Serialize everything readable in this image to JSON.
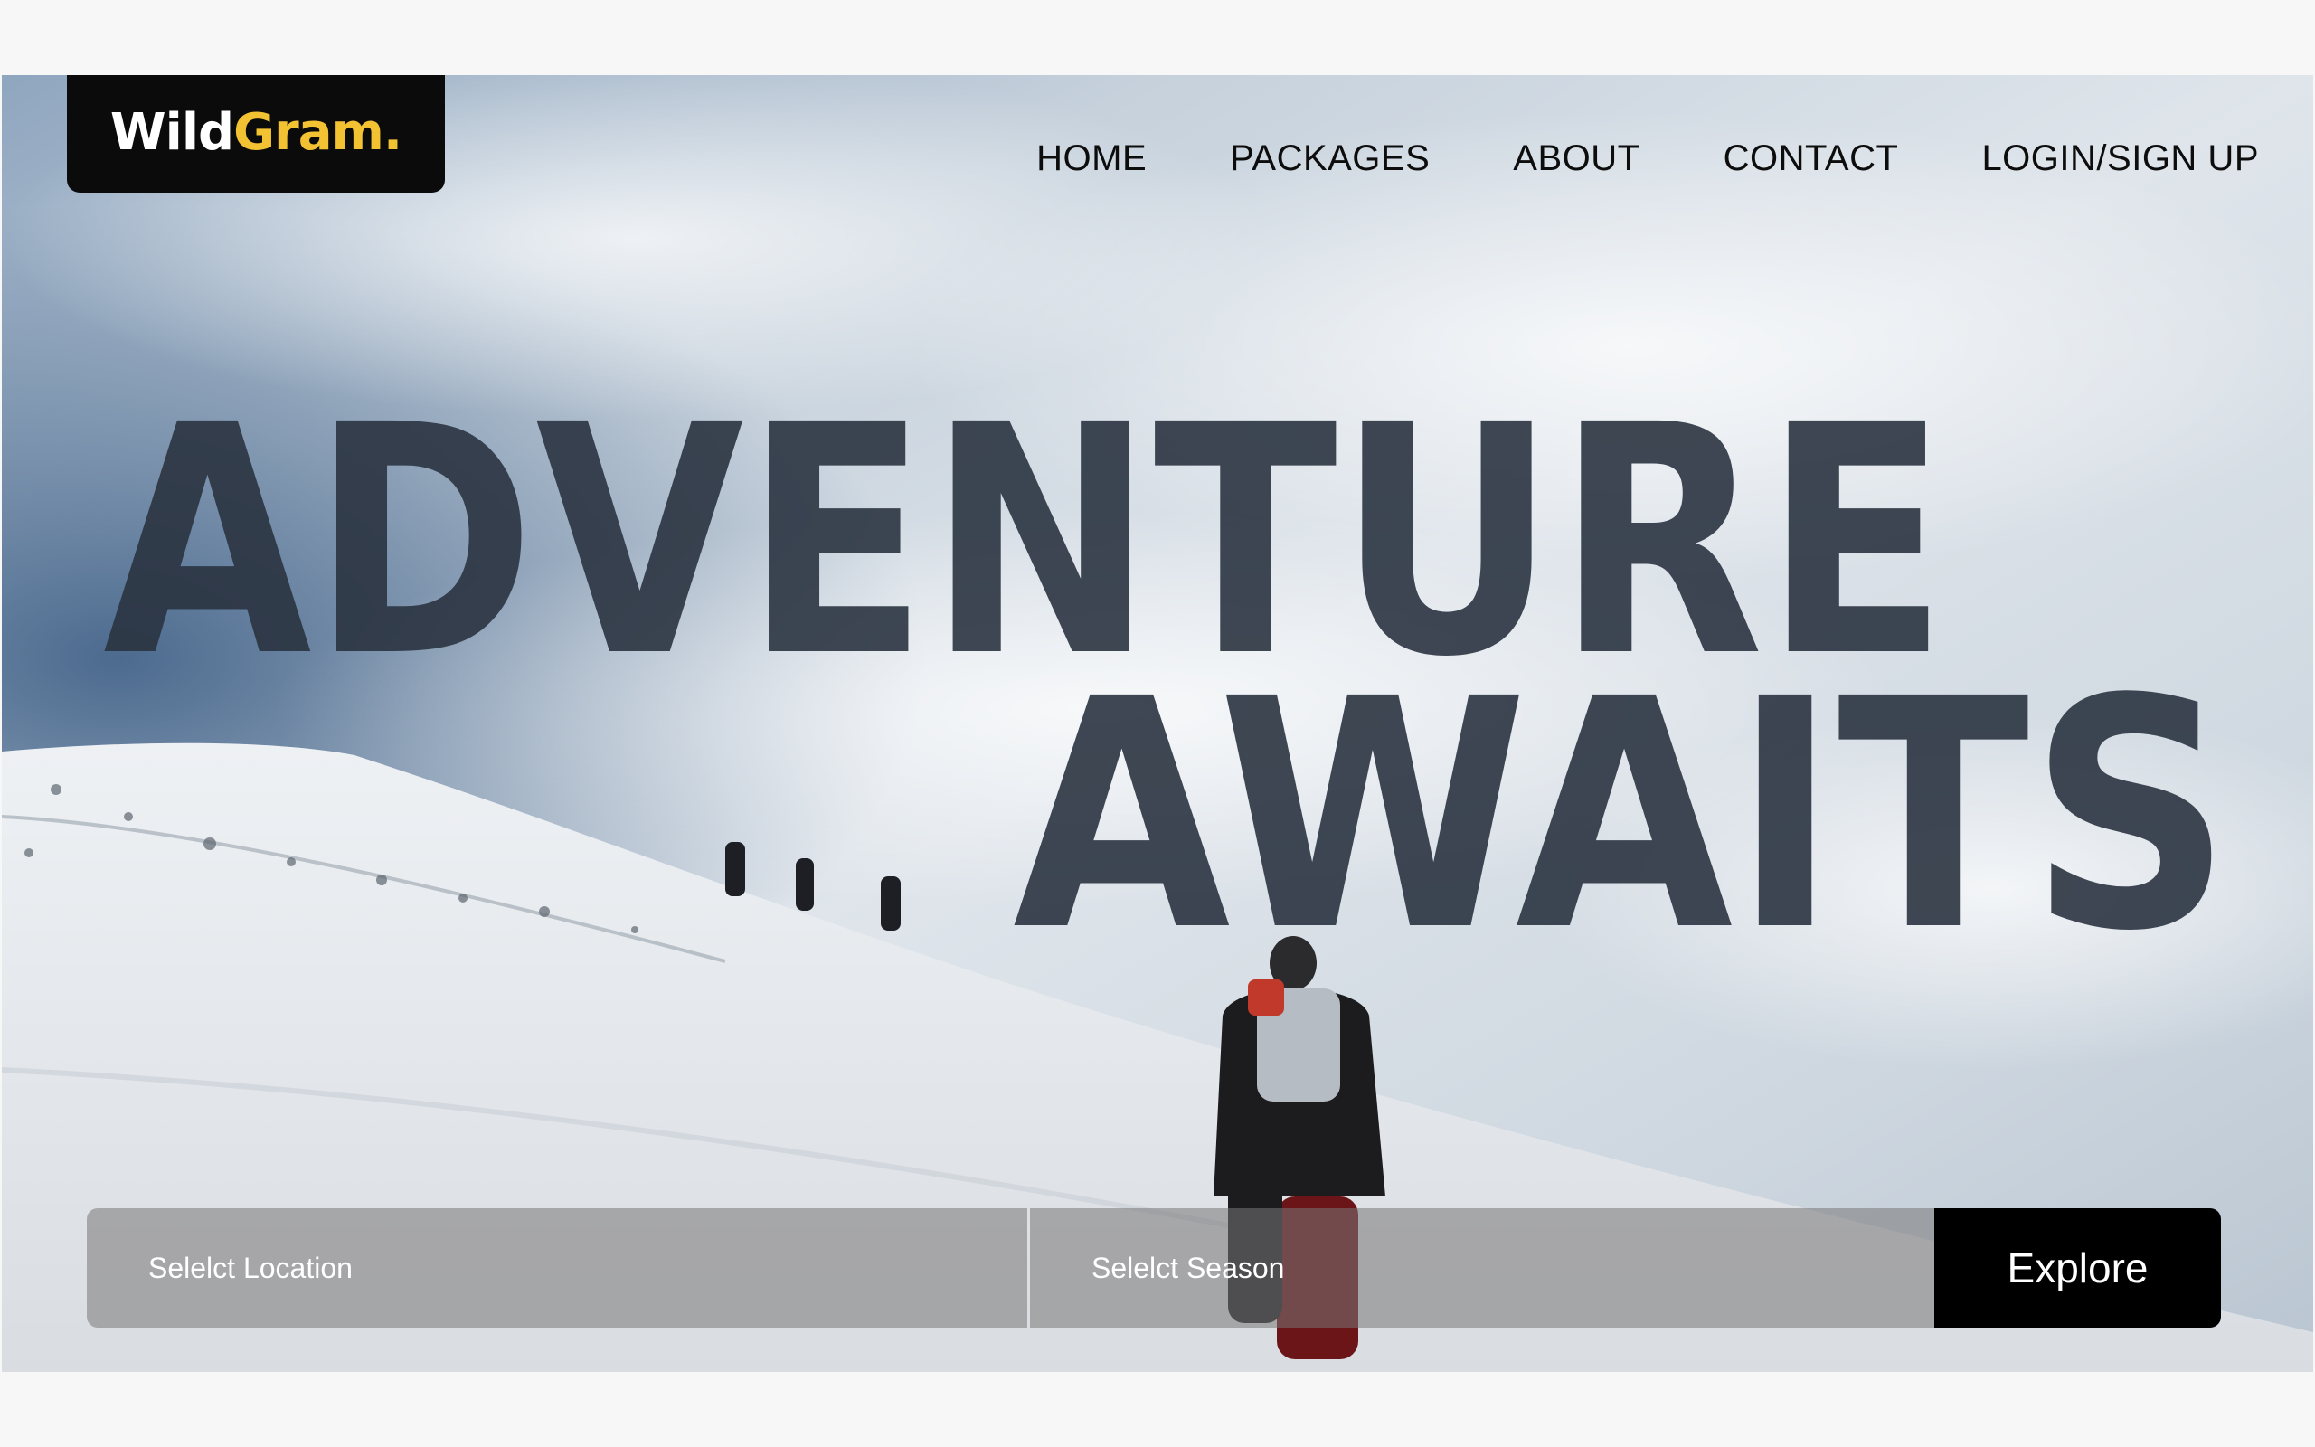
{
  "brand": {
    "name_part1": "Wild",
    "name_part2": "Gram.",
    "accent_color": "#f2c232"
  },
  "nav": {
    "items": [
      {
        "label": "HOME"
      },
      {
        "label": "PACKAGES"
      },
      {
        "label": "ABOUT"
      },
      {
        "label": "CONTACT"
      },
      {
        "label": "LOGIN/SIGN UP"
      }
    ]
  },
  "hero": {
    "headline_line1": "ADVENTURE",
    "headline_line2": "AWAITS",
    "headline_color": "#2a3340"
  },
  "search": {
    "location_placeholder": "Selelct Location",
    "season_placeholder": "Selelct Season",
    "explore_label": "Explore"
  }
}
